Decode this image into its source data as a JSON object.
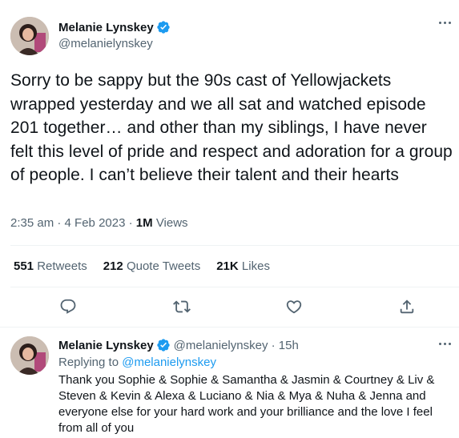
{
  "main_tweet": {
    "author_name": "Melanie Lynskey",
    "author_handle": "@melanielynskey",
    "text": "Sorry to be sappy but the 90s cast of Yellowjackets wrapped yesterday and we all sat and watched episode 201 together… and other than my siblings, I have never felt this level of pride and respect and adoration for a group of people. I can’t believe their talent and their hearts",
    "time": "2:35 am",
    "date": "4 Feb 2023",
    "views_count": "1M",
    "views_label": "Views",
    "stats": [
      {
        "count": "551",
        "label": "Retweets"
      },
      {
        "count": "212",
        "label": "Quote Tweets"
      },
      {
        "count": "21K",
        "label": "Likes"
      }
    ],
    "actions": [
      "reply-icon",
      "retweet-icon",
      "like-icon",
      "share-icon"
    ]
  },
  "reply": {
    "author_name": "Melanie Lynskey",
    "author_handle": "@melanielynskey",
    "age": "15h",
    "replying_prefix": "Replying to",
    "replying_to": "@melanielynskey",
    "text": "Thank you Sophie & Sophie & Samantha & Jasmin & Courtney & Liv & Steven & Kevin & Alexa & Luciano & Nia & Mya & Nuha & Jenna and everyone else for your hard work and your brilliance and the love I feel from all of you"
  },
  "colors": {
    "text": "#0f1419",
    "secondary": "#536471",
    "accent": "#1d9bf0",
    "divider": "#eff3f4"
  }
}
